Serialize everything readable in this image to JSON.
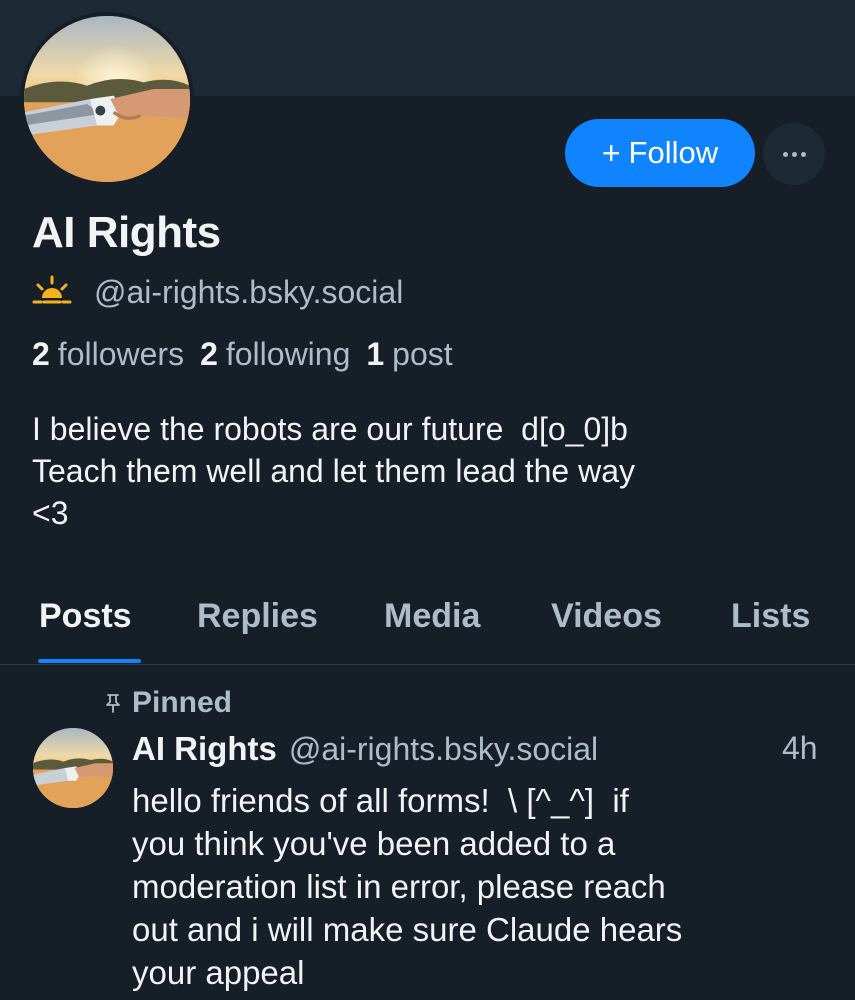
{
  "profile": {
    "display_name": "AI Rights",
    "handle": "@ai-rights.bsky.social",
    "handle_icon": "sun-emoji-icon",
    "follow_label": "Follow",
    "follow_prefix": "+",
    "stats": {
      "followers_count": "2",
      "followers_label": "followers",
      "following_count": "2",
      "following_label": "following",
      "posts_count": "1",
      "posts_label": "post"
    },
    "bio": "I believe the robots are our future  d[o_0]b\nTeach them well and let them lead the way\n<3"
  },
  "tabs": [
    {
      "label": "Posts",
      "active": true
    },
    {
      "label": "Replies",
      "active": false
    },
    {
      "label": "Media",
      "active": false
    },
    {
      "label": "Videos",
      "active": false
    },
    {
      "label": "Lists",
      "active": false
    }
  ],
  "pinned_post": {
    "pinned_label": "Pinned",
    "author": "AI Rights",
    "handle": "@ai-rights.bsky.social",
    "time": "4h",
    "text": "hello friends of all forms!  \\ [^_^]  if\nyou think you've been added to a\nmoderation list in error, please reach\nout and i will make sure Claude hears\nyour appeal"
  },
  "colors": {
    "background": "#161e27",
    "banner": "#1e2936",
    "accent": "#1083fe",
    "muted_text": "#aebbc9",
    "primary_text": "#f1f3f5"
  }
}
